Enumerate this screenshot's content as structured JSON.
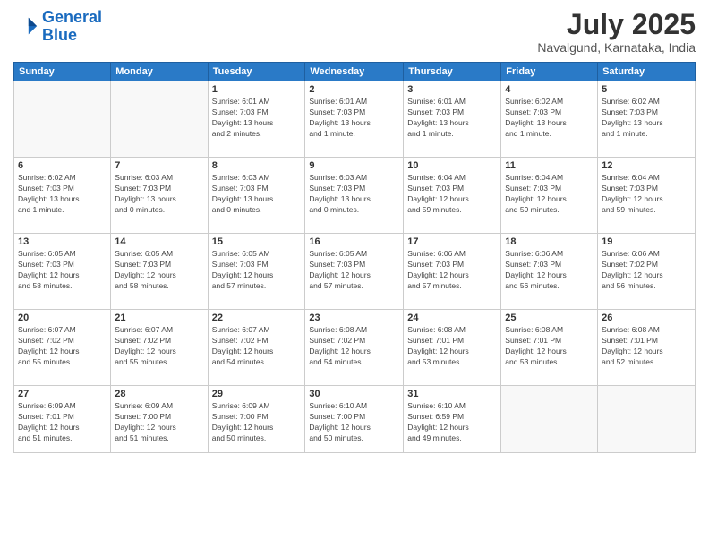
{
  "logo": {
    "line1": "General",
    "line2": "Blue"
  },
  "title": "July 2025",
  "location": "Navalgund, Karnataka, India",
  "days_header": [
    "Sunday",
    "Monday",
    "Tuesday",
    "Wednesday",
    "Thursday",
    "Friday",
    "Saturday"
  ],
  "weeks": [
    [
      {
        "day": "",
        "info": ""
      },
      {
        "day": "",
        "info": ""
      },
      {
        "day": "1",
        "info": "Sunrise: 6:01 AM\nSunset: 7:03 PM\nDaylight: 13 hours\nand 2 minutes."
      },
      {
        "day": "2",
        "info": "Sunrise: 6:01 AM\nSunset: 7:03 PM\nDaylight: 13 hours\nand 1 minute."
      },
      {
        "day": "3",
        "info": "Sunrise: 6:01 AM\nSunset: 7:03 PM\nDaylight: 13 hours\nand 1 minute."
      },
      {
        "day": "4",
        "info": "Sunrise: 6:02 AM\nSunset: 7:03 PM\nDaylight: 13 hours\nand 1 minute."
      },
      {
        "day": "5",
        "info": "Sunrise: 6:02 AM\nSunset: 7:03 PM\nDaylight: 13 hours\nand 1 minute."
      }
    ],
    [
      {
        "day": "6",
        "info": "Sunrise: 6:02 AM\nSunset: 7:03 PM\nDaylight: 13 hours\nand 1 minute."
      },
      {
        "day": "7",
        "info": "Sunrise: 6:03 AM\nSunset: 7:03 PM\nDaylight: 13 hours\nand 0 minutes."
      },
      {
        "day": "8",
        "info": "Sunrise: 6:03 AM\nSunset: 7:03 PM\nDaylight: 13 hours\nand 0 minutes."
      },
      {
        "day": "9",
        "info": "Sunrise: 6:03 AM\nSunset: 7:03 PM\nDaylight: 13 hours\nand 0 minutes."
      },
      {
        "day": "10",
        "info": "Sunrise: 6:04 AM\nSunset: 7:03 PM\nDaylight: 12 hours\nand 59 minutes."
      },
      {
        "day": "11",
        "info": "Sunrise: 6:04 AM\nSunset: 7:03 PM\nDaylight: 12 hours\nand 59 minutes."
      },
      {
        "day": "12",
        "info": "Sunrise: 6:04 AM\nSunset: 7:03 PM\nDaylight: 12 hours\nand 59 minutes."
      }
    ],
    [
      {
        "day": "13",
        "info": "Sunrise: 6:05 AM\nSunset: 7:03 PM\nDaylight: 12 hours\nand 58 minutes."
      },
      {
        "day": "14",
        "info": "Sunrise: 6:05 AM\nSunset: 7:03 PM\nDaylight: 12 hours\nand 58 minutes."
      },
      {
        "day": "15",
        "info": "Sunrise: 6:05 AM\nSunset: 7:03 PM\nDaylight: 12 hours\nand 57 minutes."
      },
      {
        "day": "16",
        "info": "Sunrise: 6:05 AM\nSunset: 7:03 PM\nDaylight: 12 hours\nand 57 minutes."
      },
      {
        "day": "17",
        "info": "Sunrise: 6:06 AM\nSunset: 7:03 PM\nDaylight: 12 hours\nand 57 minutes."
      },
      {
        "day": "18",
        "info": "Sunrise: 6:06 AM\nSunset: 7:03 PM\nDaylight: 12 hours\nand 56 minutes."
      },
      {
        "day": "19",
        "info": "Sunrise: 6:06 AM\nSunset: 7:02 PM\nDaylight: 12 hours\nand 56 minutes."
      }
    ],
    [
      {
        "day": "20",
        "info": "Sunrise: 6:07 AM\nSunset: 7:02 PM\nDaylight: 12 hours\nand 55 minutes."
      },
      {
        "day": "21",
        "info": "Sunrise: 6:07 AM\nSunset: 7:02 PM\nDaylight: 12 hours\nand 55 minutes."
      },
      {
        "day": "22",
        "info": "Sunrise: 6:07 AM\nSunset: 7:02 PM\nDaylight: 12 hours\nand 54 minutes."
      },
      {
        "day": "23",
        "info": "Sunrise: 6:08 AM\nSunset: 7:02 PM\nDaylight: 12 hours\nand 54 minutes."
      },
      {
        "day": "24",
        "info": "Sunrise: 6:08 AM\nSunset: 7:01 PM\nDaylight: 12 hours\nand 53 minutes."
      },
      {
        "day": "25",
        "info": "Sunrise: 6:08 AM\nSunset: 7:01 PM\nDaylight: 12 hours\nand 53 minutes."
      },
      {
        "day": "26",
        "info": "Sunrise: 6:08 AM\nSunset: 7:01 PM\nDaylight: 12 hours\nand 52 minutes."
      }
    ],
    [
      {
        "day": "27",
        "info": "Sunrise: 6:09 AM\nSunset: 7:01 PM\nDaylight: 12 hours\nand 51 minutes."
      },
      {
        "day": "28",
        "info": "Sunrise: 6:09 AM\nSunset: 7:00 PM\nDaylight: 12 hours\nand 51 minutes."
      },
      {
        "day": "29",
        "info": "Sunrise: 6:09 AM\nSunset: 7:00 PM\nDaylight: 12 hours\nand 50 minutes."
      },
      {
        "day": "30",
        "info": "Sunrise: 6:10 AM\nSunset: 7:00 PM\nDaylight: 12 hours\nand 50 minutes."
      },
      {
        "day": "31",
        "info": "Sunrise: 6:10 AM\nSunset: 6:59 PM\nDaylight: 12 hours\nand 49 minutes."
      },
      {
        "day": "",
        "info": ""
      },
      {
        "day": "",
        "info": ""
      }
    ]
  ]
}
